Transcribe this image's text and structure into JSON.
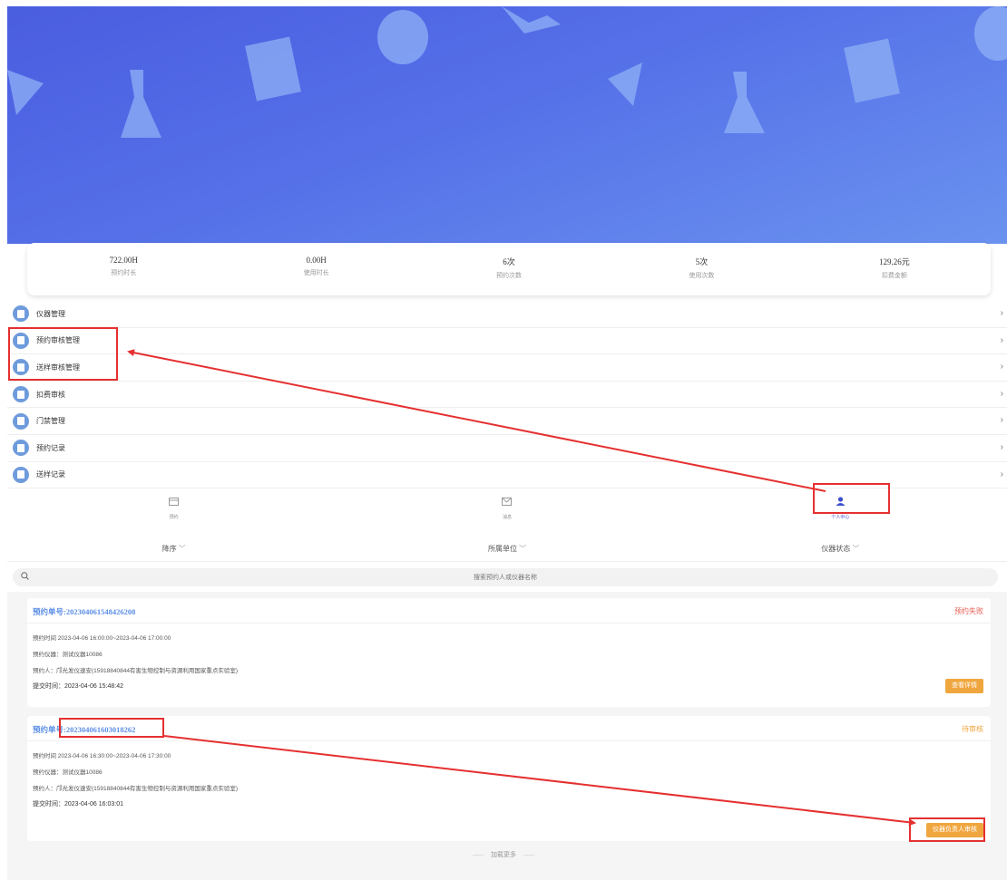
{
  "colors": {
    "banner_start": "#4a5de0",
    "banner_end": "#6a92ef",
    "menu_icon": "#6e9bdc",
    "link_blue": "#5b8ee6",
    "status_failed": "#e85a4f",
    "status_pending": "#f0a63e",
    "button_orange": "#f0a63e",
    "active_tab": "#3a4fcf",
    "annotation_red": "#e53030"
  },
  "stats": [
    {
      "value": "722.00H",
      "label": "预约时长"
    },
    {
      "value": "0.00H",
      "label": "使用时长"
    },
    {
      "value": "6次",
      "label": "预约次数"
    },
    {
      "value": "5次",
      "label": "使用次数"
    },
    {
      "value": "129.26元",
      "label": "扣费金额"
    }
  ],
  "menu": [
    {
      "label": "仪器管理",
      "icon": "document-icon"
    },
    {
      "label": "预约审核管理",
      "icon": "document-icon"
    },
    {
      "label": "送样审核管理",
      "icon": "document-icon"
    },
    {
      "label": "扣费审核",
      "icon": "document-icon"
    },
    {
      "label": "门禁管理",
      "icon": "document-icon"
    },
    {
      "label": "预约记录",
      "icon": "document-icon"
    },
    {
      "label": "送样记录",
      "icon": "document-icon"
    }
  ],
  "tabs": [
    {
      "label": "预约",
      "icon": "calendar-icon"
    },
    {
      "label": "消息",
      "icon": "mail-icon"
    },
    {
      "label": "个人中心",
      "icon": "user-icon"
    }
  ],
  "filters": [
    {
      "label": "降序"
    },
    {
      "label": "所属单位"
    },
    {
      "label": "仪器状态"
    }
  ],
  "search": {
    "placeholder": "搜索预约人或仪器名称"
  },
  "cards": [
    {
      "order_no": "预约单号:202304061548426208",
      "status": "预约失败",
      "time": "预约时间 2023-04-06 16:00:00~2023-04-06 17:00:00",
      "instrument": "预约仪器：测试仪器10086",
      "person": "预约人：邝光发仪速安(15918840844有害生物控制与资源利用国家重点实验室)",
      "submit": "提交时间：2023-04-06 15:48:42",
      "button": "查看详情"
    },
    {
      "order_no": "预约单号:202304061603018262",
      "status": "待审核",
      "time": "预约时间 2023-04-06 16:30:00~2023-04-06 17:30:00",
      "instrument": "预约仪器：测试仪器10086",
      "person": "预约人：邝光发仪速安(15918840844有害生物控制与资源利用国家重点实验室)",
      "submit": "提交时间：2023-04-06 16:03:01",
      "button": "仪器负责人审核"
    }
  ],
  "load_more": "加载更多"
}
